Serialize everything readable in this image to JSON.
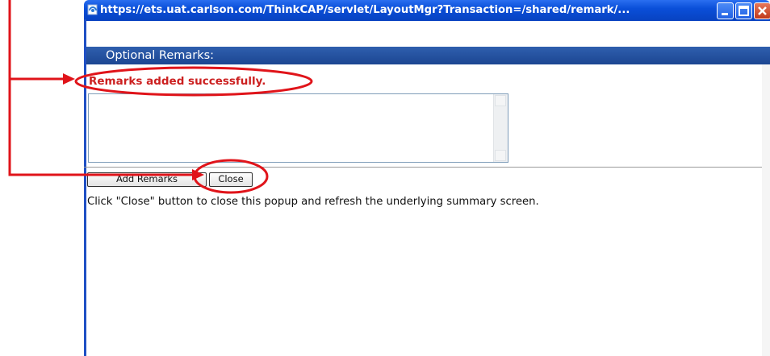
{
  "window": {
    "title": "https://ets.uat.carlson.com/ThinkCAP/servlet/LayoutMgr?Transaction=/shared/remark/...",
    "titlebar_color": "#0a4fd9"
  },
  "section": {
    "header": "Optional Remarks:"
  },
  "status": {
    "message": "Remarks added successfully.",
    "color": "#cc2020"
  },
  "remarks_textarea": {
    "value": ""
  },
  "buttons": {
    "add_remarks": "Add Remarks",
    "close": "Close"
  },
  "instruction": "Click \"Close\" button to close this popup and refresh the underlying summary screen.",
  "annotation": {
    "color": "#e0141a"
  }
}
